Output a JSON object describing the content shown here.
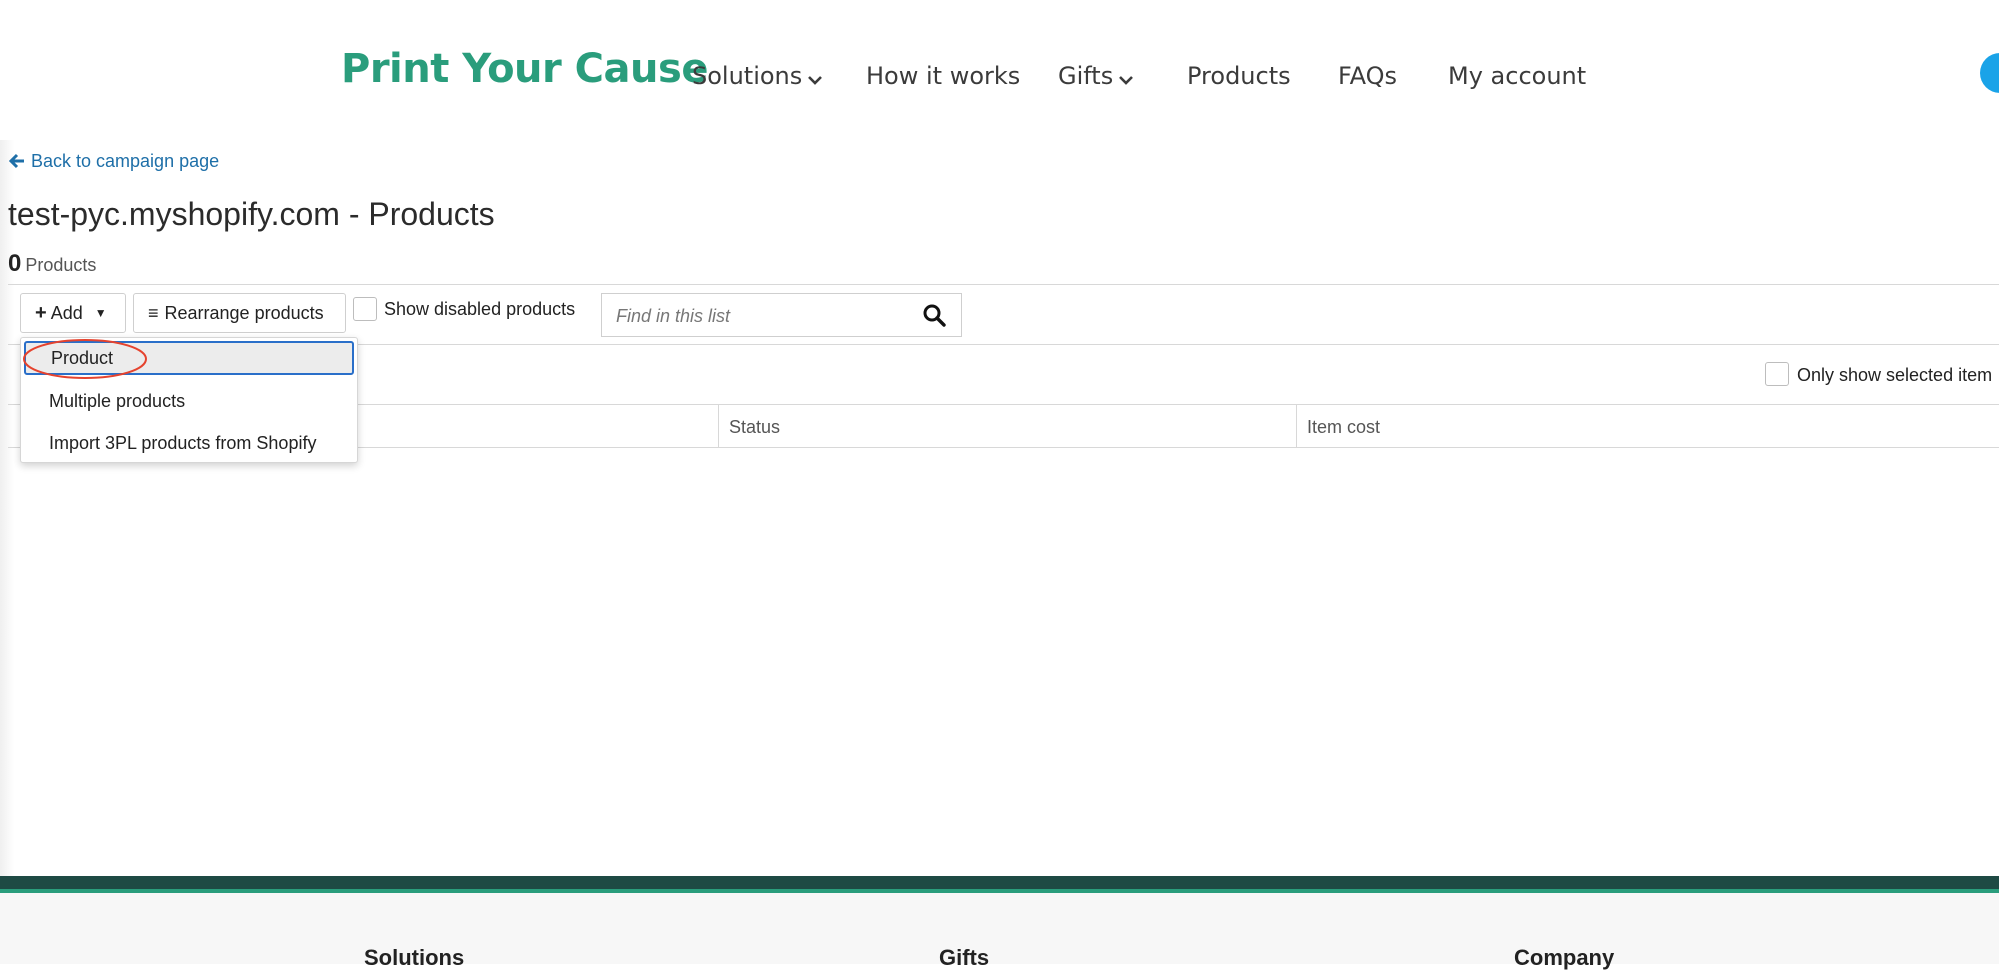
{
  "header": {
    "logo": "Print Your Cause",
    "nav": [
      {
        "label": "Solutions",
        "has_dropdown": true
      },
      {
        "label": "How it works",
        "has_dropdown": false
      },
      {
        "label": "Gifts",
        "has_dropdown": true
      },
      {
        "label": "Products",
        "has_dropdown": false
      },
      {
        "label": "FAQs",
        "has_dropdown": false
      },
      {
        "label": "My account",
        "has_dropdown": false
      }
    ]
  },
  "back_link": "Back to campaign page",
  "page_title": "test-pyc.myshopify.com - Products",
  "product_count": {
    "value": "0",
    "label": "Products"
  },
  "toolbar": {
    "add_label": "Add",
    "rearrange_label": "Rearrange products",
    "show_disabled_label": "Show disabled products",
    "search_placeholder": "Find in this list"
  },
  "only_selected_label": "Only show selected item",
  "table": {
    "columns": [
      "Status",
      "Item cost"
    ]
  },
  "add_menu": {
    "items": [
      "Product",
      "Multiple products",
      "Import 3PL products from Shopify"
    ],
    "active_index": 0
  },
  "footer": {
    "headings": [
      "Solutions",
      "Gifts",
      "Company"
    ]
  },
  "colors": {
    "brand": "#2a9d7c",
    "link": "#1e6fa8",
    "focus": "#2a6fc9",
    "annotation": "#e5432e",
    "footer_dark": "#1e4a44",
    "avatar": "#1aa3e8"
  },
  "icons": {
    "back": "arrow-left-icon",
    "add": "plus-icon",
    "caret": "caret-down-icon",
    "rearrange": "bars-icon",
    "search": "search-icon",
    "nav_dropdown": "chevron-down-icon"
  }
}
